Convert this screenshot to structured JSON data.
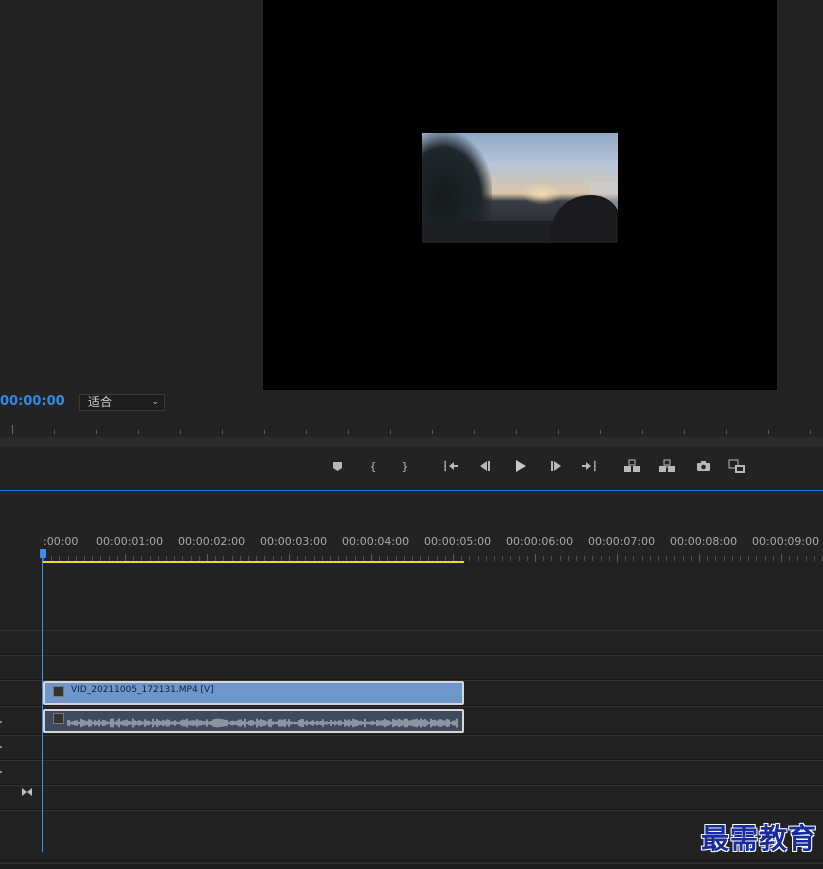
{
  "monitor": {
    "timecode": "00:00:00",
    "zoom_select": {
      "value": "适合",
      "chevron": "chevron-down-icon"
    }
  },
  "transport": {
    "buttons": [
      {
        "id": "add-marker",
        "icon": "marker-icon"
      },
      {
        "id": "mark-in",
        "label": "{"
      },
      {
        "id": "mark-out",
        "label": "}"
      },
      {
        "id": "go-to-in",
        "icon": "go-to-in-icon"
      },
      {
        "id": "step-back",
        "icon": "step-back-icon"
      },
      {
        "id": "play",
        "icon": "play-icon"
      },
      {
        "id": "step-forward",
        "icon": "step-forward-icon"
      },
      {
        "id": "go-to-out",
        "icon": "go-to-out-icon"
      },
      {
        "id": "lift",
        "icon": "lift-icon"
      },
      {
        "id": "extract",
        "icon": "extract-icon"
      },
      {
        "id": "export-frame",
        "icon": "camera-icon"
      },
      {
        "id": "compare",
        "icon": "compare-icon"
      }
    ]
  },
  "timeline": {
    "ruler_labels": [
      ":00:00",
      "00:00:01:00",
      "00:00:02:00",
      "00:00:03:00",
      "00:00:04:00",
      "00:00:05:00",
      "00:00:06:00",
      "00:00:07:00",
      "00:00:08:00",
      "00:00:09:00"
    ],
    "video_clip": {
      "label": "VID_20211005_172131.MP4 [V]"
    },
    "track_marker_icon": "bowtie-icon"
  },
  "colors": {
    "timecode": "#2d8ceb",
    "playhead": "#3b8ff0",
    "work_area": "#e8de21",
    "video_clip": "#6f96c8",
    "audio_clip": "#3f4a5e"
  },
  "watermark": "最需教育"
}
